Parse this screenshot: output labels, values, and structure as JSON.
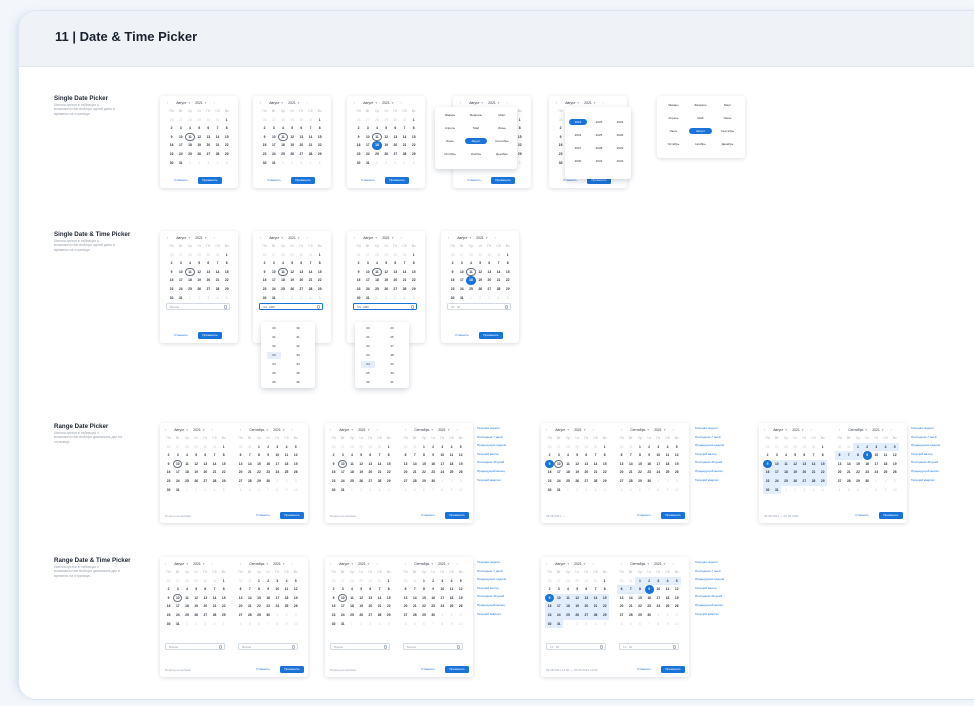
{
  "page": {
    "title": "11 | Date & Time Picker"
  },
  "sections": [
    {
      "title": "Single Date Picker",
      "desc": "Используется в таблицах с возможностью выбора одной даты и времени на странице."
    },
    {
      "title": "Single Date & Time Picker",
      "desc": "Используется в таблицах с возможностью выбора одной даты и времени на странице."
    },
    {
      "title": "Range Date Picker",
      "desc": "Используется в таблицах с возможностью выбора диапазона дат на странице."
    },
    {
      "title": "Range Date & Time Picker",
      "desc": "Используется в таблицах с возможностью выбора диапазона дат и времени на странице."
    }
  ],
  "cal": {
    "month1": "Август",
    "month2": "Сентябрь",
    "year": "2021",
    "prev": "‹",
    "next": "›",
    "caret": "▾",
    "weekdays": [
      "Пн",
      "Вт",
      "Ср",
      "Чт",
      "Пт",
      "Сб",
      "Вс"
    ],
    "aug": [
      "26",
      "27",
      "28",
      "29",
      "30",
      "31",
      "1",
      "2",
      "3",
      "4",
      "5",
      "6",
      "7",
      "8",
      "9",
      "10",
      "11",
      "12",
      "13",
      "14",
      "15",
      "16",
      "17",
      "18",
      "19",
      "20",
      "21",
      "22",
      "23",
      "24",
      "25",
      "26",
      "27",
      "28",
      "29",
      "30",
      "31",
      "1",
      "2",
      "3",
      "4",
      "5"
    ],
    "sep": [
      "30",
      "31",
      "1",
      "2",
      "3",
      "4",
      "5",
      "6",
      "7",
      "8",
      "9",
      "10",
      "11",
      "12",
      "13",
      "14",
      "15",
      "16",
      "17",
      "18",
      "19",
      "20",
      "21",
      "22",
      "23",
      "24",
      "25",
      "26",
      "27",
      "28",
      "29",
      "30",
      "1",
      "2",
      "3",
      "4",
      "5",
      "6",
      "7",
      "8",
      "9",
      "10"
    ]
  },
  "buttons": {
    "cancel": "Отменить",
    "apply": "Применить"
  },
  "months": [
    "Январь",
    "Февраль",
    "Март",
    "Апрель",
    "Май",
    "Июнь",
    "Июль",
    "Август",
    "Сентябрь",
    "Октябрь",
    "Ноябрь",
    "Декабрь"
  ],
  "years": [
    "2021",
    "2022",
    "2023",
    "2024",
    "2025",
    "2026",
    "2027",
    "2028",
    "2029",
    "2030",
    "2031",
    "2032"
  ],
  "time": {
    "placeholder": "Время",
    "focused": "ЧЧ : ММ",
    "filled": "00 : 00",
    "value1": "14 : 30",
    "value2": "12 : 30",
    "hours": [
      "00",
      "01",
      "02",
      "03",
      "04",
      "05",
      "06"
    ],
    "minutes": [
      "30",
      "31",
      "32",
      "33",
      "34",
      "35",
      "36"
    ],
    "hours2": [
      "00",
      "01",
      "02",
      "03",
      "04",
      "05",
      "06"
    ],
    "minutes2": [
      "23",
      "25",
      "37",
      "38",
      "22",
      "30",
      "31"
    ]
  },
  "presets": [
    "Текущая неделя",
    "Последние 7 дней",
    "Предыдущая неделя",
    "Текущий месяц",
    "Последние 30 дней",
    "Предыдущий месяц",
    "Текущий квартал"
  ],
  "range": {
    "placeholder": "Период не выбран",
    "value1": "09.08.2021 — ",
    "value2": "09.08.2021 — 02.09.2021",
    "value3": "09.08.2021 14:30 — 09.09.2021 12:30"
  }
}
